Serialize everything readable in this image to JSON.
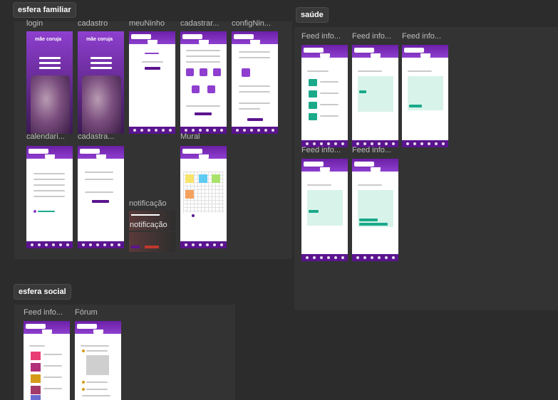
{
  "sections": {
    "familiar": "esfera familiar",
    "saude": "saúde",
    "social": "esfera social"
  },
  "frames": {
    "login": "login",
    "cadastro": "cadastro",
    "meuNinho": "meuNinho",
    "cadastrar": "cadastrar...",
    "config": "configNin...",
    "calendario": "calendari...",
    "cadastra": "cadastra...",
    "mural": "Mural",
    "notificacao": "notificação",
    "notificacao_overlay": "notificação",
    "saude_feed1": "Feed info...",
    "saude_feed2": "Feed info...",
    "saude_feed3": "Feed info...",
    "saude_feed4": "Feed info...",
    "saude_feed5": "Feed info...",
    "social_feed": "Feed info...",
    "forum": "Fórum"
  },
  "brand": "mãe coruja",
  "colors": {
    "primary": "#6b1fa6",
    "primary_dark": "#5b148f",
    "teal": "#1aaa8a",
    "canvas": "#2c2c2c"
  }
}
